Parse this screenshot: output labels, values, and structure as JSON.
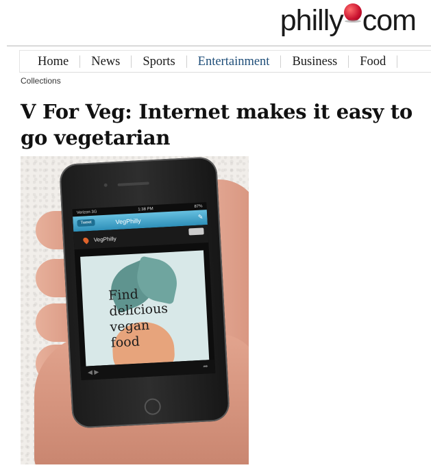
{
  "site": {
    "logo_left": "philly",
    "logo_right": "com"
  },
  "nav": {
    "items": [
      {
        "label": "Home"
      },
      {
        "label": "News"
      },
      {
        "label": "Sports"
      },
      {
        "label": "Entertainment"
      },
      {
        "label": "Business"
      },
      {
        "label": "Food"
      }
    ],
    "active_index": 3
  },
  "breadcrumb": "Collections",
  "headline": "V For Veg: Internet makes it easy to go vegetarian",
  "photo": {
    "status_left": "Verizon 3G",
    "status_time": "1:38 PM",
    "status_right": "87%",
    "tweet_label": "Tweet",
    "app_title": "VegPhilly",
    "row_label": "VegPhilly",
    "promo_text": "Find\ndelicious\nvegan\nfood"
  },
  "colors": {
    "nav_active": "#1f4e79",
    "logo_dot": "#c8102e"
  }
}
